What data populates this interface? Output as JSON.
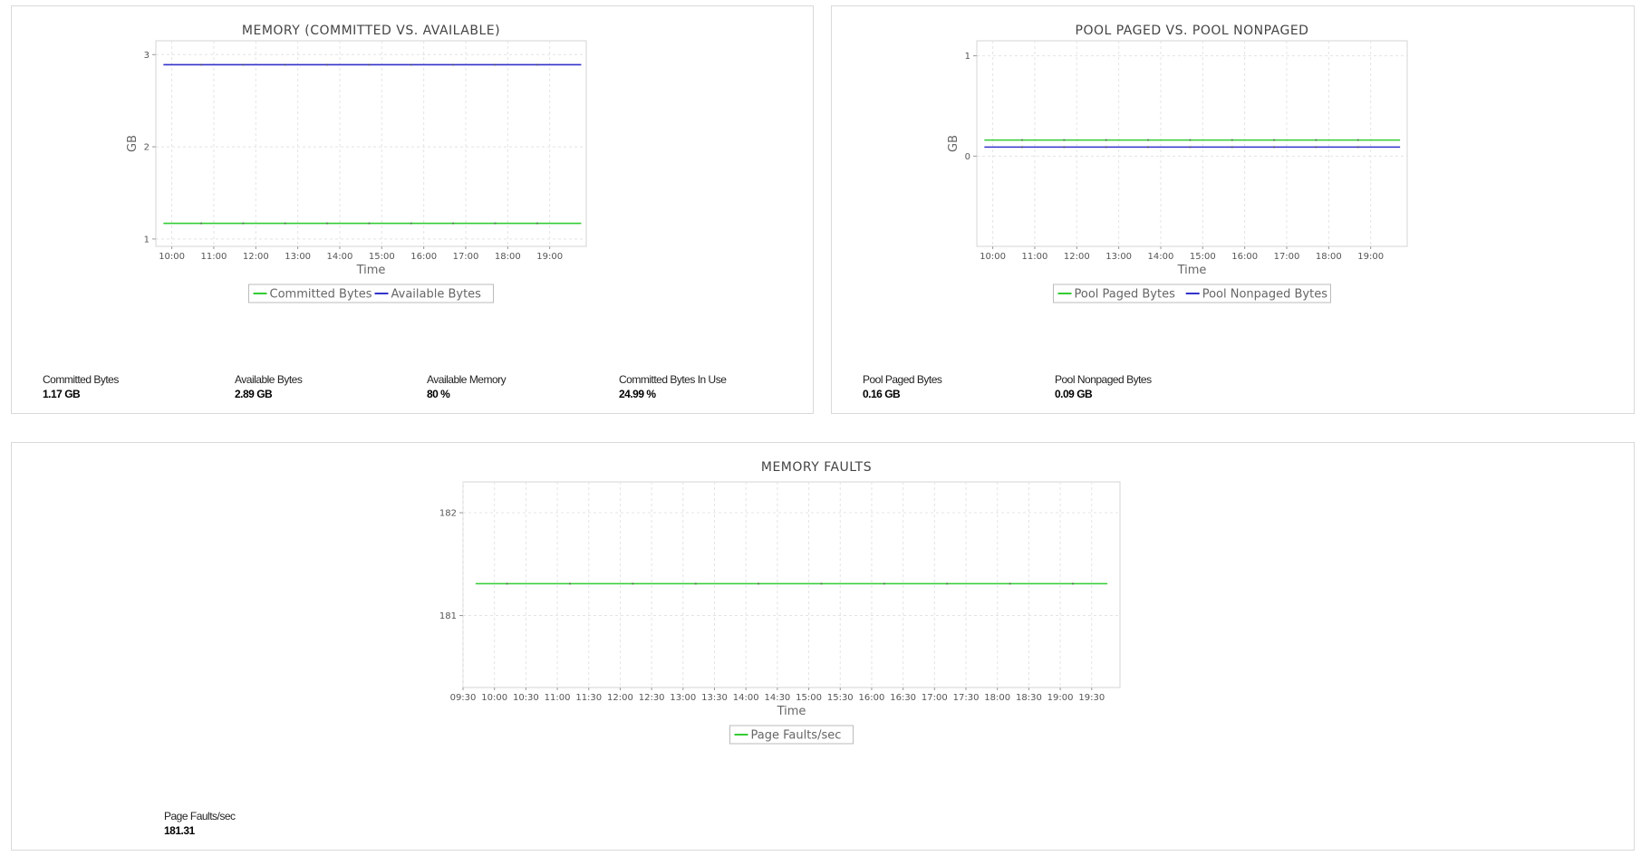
{
  "chart_data": [
    {
      "id": "memory",
      "type": "line",
      "title": "MEMORY (COMMITTED VS. AVAILABLE)",
      "xlabel": "Time",
      "ylabel": "GB",
      "x_ticks": [
        "10:00",
        "11:00",
        "12:00",
        "13:00",
        "14:00",
        "15:00",
        "16:00",
        "17:00",
        "18:00",
        "19:00"
      ],
      "x_range": [
        9.62,
        19.87
      ],
      "x_start": 9.8,
      "x_end": 19.75,
      "marker_x": [
        10.7,
        11.7,
        12.7,
        13.7,
        14.7,
        15.7,
        16.7,
        17.7,
        18.7
      ],
      "ylim": [
        0.92,
        3.15
      ],
      "y_ticks": [
        1,
        2,
        3
      ],
      "y_tick_labels": [
        "1",
        "2",
        "3"
      ],
      "grid": true,
      "legend": "bottom",
      "series": [
        {
          "name": "Committed Bytes",
          "color": "#33cc33",
          "values": [
            1.17,
            1.17
          ]
        },
        {
          "name": "Available Bytes",
          "color": "#3333cc",
          "values": [
            2.89,
            2.89
          ]
        }
      ]
    },
    {
      "id": "pool",
      "type": "line",
      "title": "POOL PAGED VS. POOL NONPAGED",
      "xlabel": "Time",
      "ylabel": "GB",
      "x_ticks": [
        "10:00",
        "11:00",
        "12:00",
        "13:00",
        "14:00",
        "15:00",
        "16:00",
        "17:00",
        "18:00",
        "19:00"
      ],
      "x_range": [
        9.62,
        19.87
      ],
      "x_start": 9.8,
      "x_end": 19.7,
      "marker_x": [
        10.7,
        11.7,
        12.7,
        13.7,
        14.7,
        15.7,
        16.7,
        17.7,
        18.7
      ],
      "ylim": [
        -0.9,
        1.15
      ],
      "y_ticks": [
        0,
        1
      ],
      "y_tick_labels": [
        "0",
        "1"
      ],
      "grid": true,
      "legend": "bottom",
      "series": [
        {
          "name": "Pool Paged Bytes",
          "color": "#33cc33",
          "values": [
            0.16,
            0.16
          ]
        },
        {
          "name": "Pool Nonpaged Bytes",
          "color": "#3333cc",
          "values": [
            0.09,
            0.09
          ]
        }
      ]
    },
    {
      "id": "faults",
      "type": "line",
      "title": "MEMORY FAULTS",
      "xlabel": "Time",
      "ylabel": "",
      "x_ticks": [
        "09:30",
        "10:00",
        "10:30",
        "11:00",
        "11:30",
        "12:00",
        "12:30",
        "13:00",
        "13:30",
        "14:00",
        "14:30",
        "15:00",
        "15:30",
        "16:00",
        "16:30",
        "17:00",
        "17:30",
        "18:00",
        "18:30",
        "19:00",
        "19:30"
      ],
      "x_range": [
        9.5,
        19.95
      ],
      "x_start": 9.7,
      "x_end": 19.75,
      "marker_x": [
        10.2,
        11.2,
        12.2,
        13.2,
        14.2,
        15.2,
        16.2,
        17.2,
        18.2,
        19.2
      ],
      "ylim": [
        180.3,
        182.3
      ],
      "y_ticks": [
        181,
        182
      ],
      "y_tick_labels": [
        "181",
        "182"
      ],
      "grid": true,
      "legend": "bottom",
      "series": [
        {
          "name": "Page Faults/sec",
          "color": "#33cc33",
          "values": [
            181.31,
            181.31
          ]
        }
      ]
    }
  ],
  "stats": {
    "memory": [
      {
        "label": "Committed Bytes",
        "value": "1.17 GB"
      },
      {
        "label": "Available Bytes",
        "value": "2.89 GB"
      },
      {
        "label": "Available Memory",
        "value": "80 %"
      },
      {
        "label": "Committed Bytes In Use",
        "value": "24.99 %"
      }
    ],
    "pool": [
      {
        "label": "Pool Paged Bytes",
        "value": "0.16 GB"
      },
      {
        "label": "Pool Nonpaged Bytes",
        "value": "0.09 GB"
      }
    ],
    "faults": [
      {
        "label": "Page Faults/sec",
        "value": "181.31"
      }
    ]
  }
}
